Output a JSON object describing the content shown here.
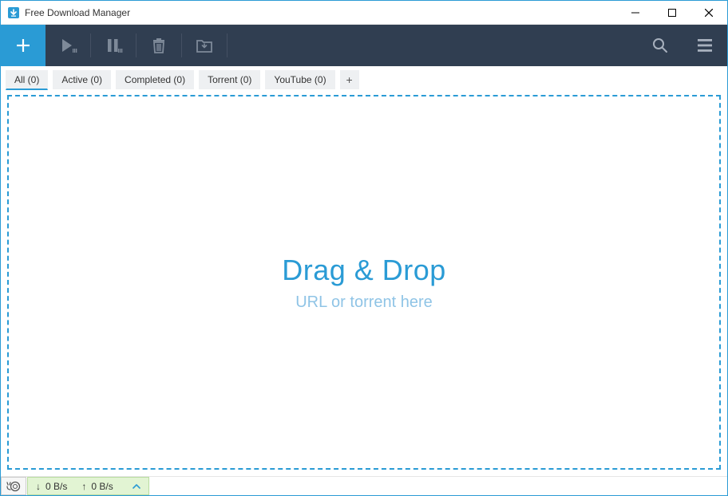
{
  "window": {
    "title": "Free Download Manager"
  },
  "filters": [
    {
      "label": "All (0)",
      "active": true
    },
    {
      "label": "Active (0)",
      "active": false
    },
    {
      "label": "Completed (0)",
      "active": false
    },
    {
      "label": "Torrent (0)",
      "active": false
    },
    {
      "label": "YouTube (0)",
      "active": false
    }
  ],
  "drop": {
    "title": "Drag & Drop",
    "subtitle": "URL or torrent here"
  },
  "status": {
    "down": "0 B/s",
    "up": "0 B/s"
  }
}
